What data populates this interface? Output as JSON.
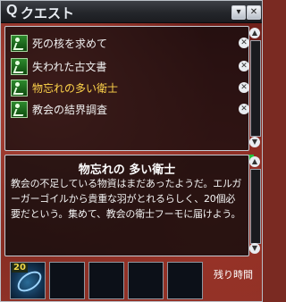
{
  "window": {
    "title_letter": "Q",
    "title": "クエスト"
  },
  "title_buttons": {
    "minimize": "▾",
    "close": "✕"
  },
  "quests": [
    {
      "label": "死の核を求めて",
      "active": false
    },
    {
      "label": "失われた古文書",
      "active": false
    },
    {
      "label": "物忘れの多い衛士",
      "active": true
    },
    {
      "label": "教会の結界調査",
      "active": false
    }
  ],
  "remove_glyph": "✕",
  "detail": {
    "title": "物忘れの 多い衛士",
    "text": "教会の不足している物資はまだあったようだ。エルガーガーゴイルから貴重な羽がとれるらしく、20個必要だという。集めて、教会の衛士フーモに届けよう。"
  },
  "reward_slots": [
    {
      "count": "20",
      "filled": true
    },
    {
      "count": "",
      "filled": false
    },
    {
      "count": "",
      "filled": false
    },
    {
      "count": "",
      "filled": false
    },
    {
      "count": "",
      "filled": false
    }
  ],
  "remaining_time_label": "残り時間",
  "colors": {
    "active_quest": "#ffd44a",
    "quest_icon": "#2d8a2d",
    "frame": "#c7ccd4"
  }
}
